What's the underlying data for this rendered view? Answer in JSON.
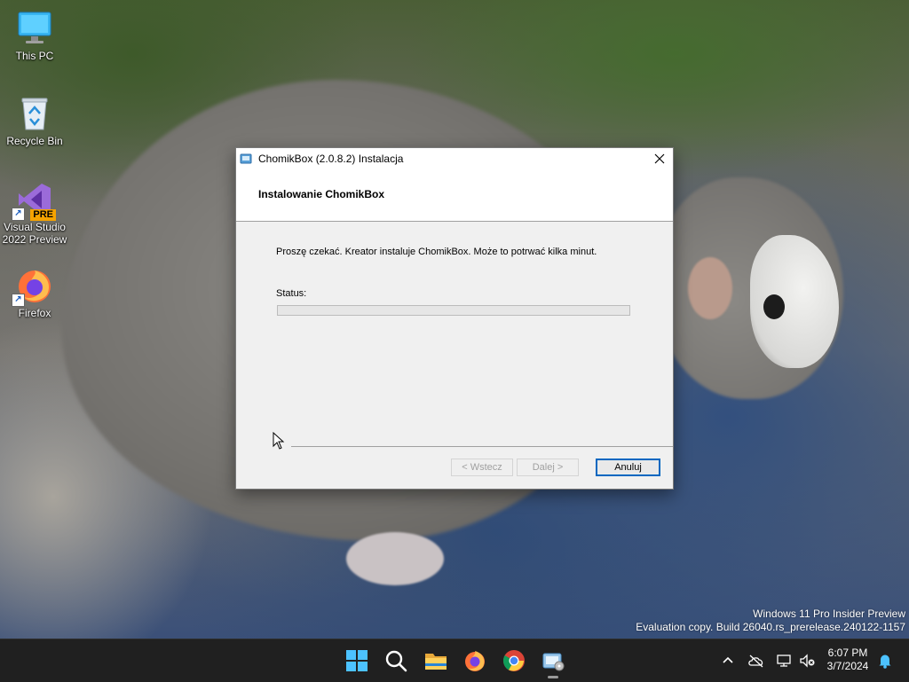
{
  "desktop": {
    "icons": [
      {
        "label": "This PC",
        "icon": "computer-icon"
      },
      {
        "label": "Recycle Bin",
        "icon": "recycle-bin-icon"
      },
      {
        "label": "Visual Studio 2022 Preview",
        "icon": "visual-studio-icon",
        "badge": "PRE"
      },
      {
        "label": "Firefox",
        "icon": "firefox-icon"
      }
    ],
    "watermark": {
      "line1": "Windows 11 Pro Insider Preview",
      "line2": "Evaluation copy. Build 26040.rs_prerelease.240122-1157"
    }
  },
  "dialog": {
    "title": "ChomikBox (2.0.8.2) Instalacja",
    "header": "Instalowanie ChomikBox",
    "message": "Proszę czekać. Kreator instaluje ChomikBox. Może to potrwać kilka minut.",
    "status_label": "Status:",
    "progress": 0,
    "buttons": {
      "back": "< Wstecz",
      "next": "Dalej >",
      "cancel": "Anuluj"
    }
  },
  "taskbar": {
    "pinned": [
      "windows-start-icon",
      "search-icon",
      "file-explorer-icon",
      "firefox-icon",
      "chrome-icon",
      "installer-icon"
    ],
    "tray": [
      "chevron-up-icon",
      "onedrive-icon",
      "network-icon",
      "volume-muted-icon",
      "notification-bell-icon"
    ],
    "time": "6:07 PM",
    "date": "3/7/2024"
  },
  "colors": {
    "accent": "#0067c0",
    "taskbar": "#202020",
    "dialog_bg": "#f0f0f0"
  }
}
